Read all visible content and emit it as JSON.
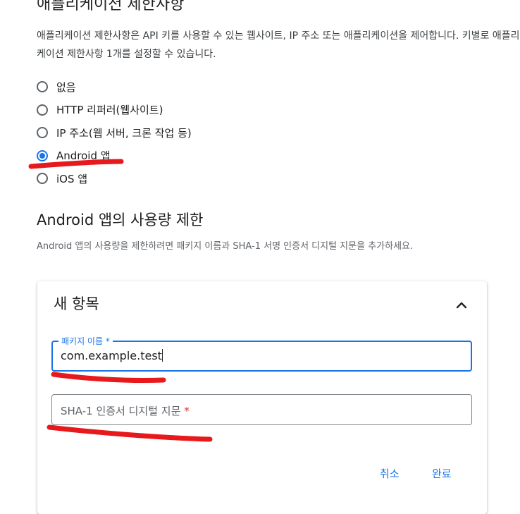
{
  "section": {
    "title": "애플리케이션 제한사항",
    "description": "애플리케이션 제한사항은 API 키를 사용할 수 있는 웹사이트, IP 주소 또는 애플리케이션을 제어합니다. 키별로 애플리케이션 제한사항 1개를 설정할 수 있습니다."
  },
  "restrictions": {
    "selected": "Android 앱",
    "options": [
      {
        "label": "없음",
        "checked": false
      },
      {
        "label": "HTTP 리퍼러(웹사이트)",
        "checked": false
      },
      {
        "label": "IP 주소(웹 서버, 크론 작업 등)",
        "checked": false
      },
      {
        "label": "Android 앱",
        "checked": true
      },
      {
        "label": "iOS 앱",
        "checked": false
      }
    ]
  },
  "android": {
    "title": "Android 앱의 사용량 제한",
    "description": "Android 앱의 사용량을 제한하려면 패키지 이름과 SHA-1 서명 인증서 디지털 지문을 추가하세요."
  },
  "card": {
    "title": "새 항목",
    "package_field": {
      "label": "패키지 이름",
      "required_mark": "*",
      "value": "com.example.test"
    },
    "sha_field": {
      "label": "SHA-1 인증서 디지털 지문",
      "required_mark": "*",
      "value": ""
    },
    "cancel_label": "취소",
    "done_label": "완료"
  },
  "colors": {
    "accent": "#1a73e8",
    "required": "#d93025",
    "annotation": "#e8191c"
  }
}
